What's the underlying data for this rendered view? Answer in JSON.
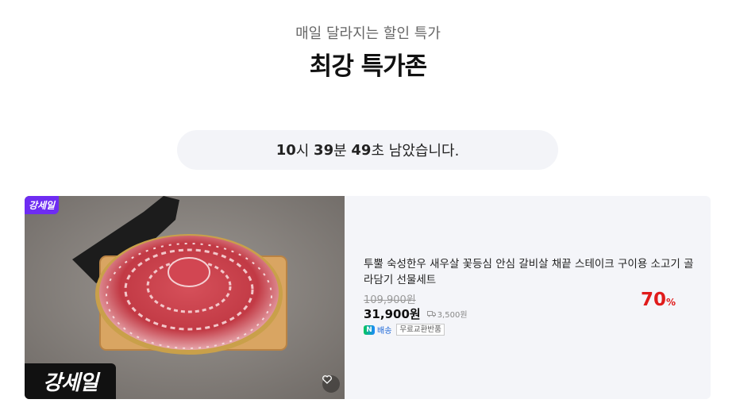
{
  "header": {
    "subtitle": "매일 달라지는 할인 특가",
    "title": "최강 특가존"
  },
  "timer": {
    "hours": "10",
    "hours_unit": "시",
    "minutes": "39",
    "minutes_unit": "분",
    "seconds": "49",
    "seconds_unit": "초",
    "suffix": "남았습니다."
  },
  "product": {
    "badge_small": "강세일",
    "badge_big": "강세일",
    "name": "투뿔 숙성한우 새우살 꽃등심 안심 갈비살 채끝 스테이크 구이용 소고기 골라담기 선물세트",
    "original_price": "109,900원",
    "price": "31,900원",
    "shipping_fee": "3,500원",
    "delivery_label": "배송",
    "tag_label": "무료교환반품",
    "discount": "70",
    "discount_unit": "%",
    "brand_color": "#6e2cf2",
    "discount_color": "#e01b1b",
    "icons": [
      "heart-icon",
      "truck-icon",
      "naver-logo-icon"
    ]
  }
}
